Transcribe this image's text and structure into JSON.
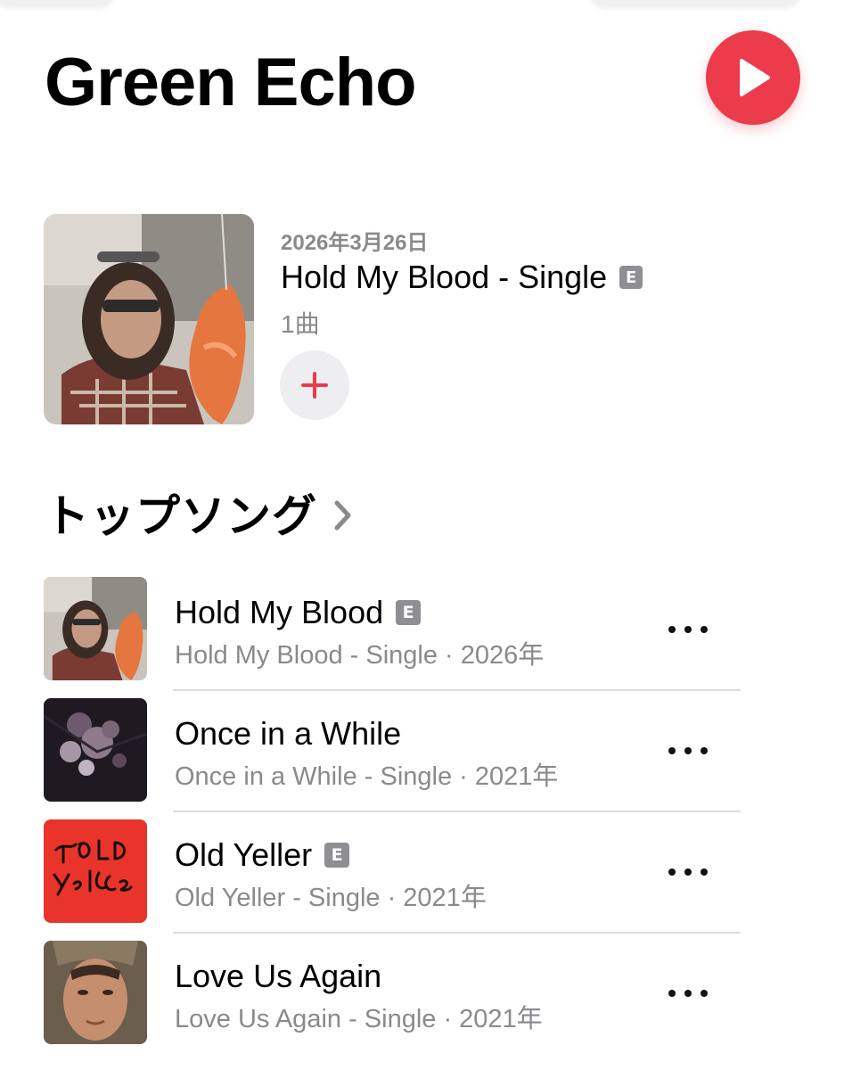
{
  "artist": {
    "name": "Green Echo"
  },
  "colors": {
    "accent": "#ec3b4b",
    "secondary_text": "#8a8a8e",
    "badge": "#8e8e93"
  },
  "icons": {
    "play": "play-icon",
    "add": "plus-icon",
    "chevron": "chevron-right-icon",
    "more": "ellipsis-icon"
  },
  "latest_release": {
    "date": "2026年3月26日",
    "title": "Hold My Blood - Single",
    "explicit_badge": "E",
    "track_count": "1曲"
  },
  "top_songs": {
    "header": "トップソング",
    "items": [
      {
        "title": "Hold My Blood",
        "explicit": true,
        "explicit_badge": "E",
        "subtitle": "Hold My Blood - Single · 2026年"
      },
      {
        "title": "Once in a While",
        "explicit": false,
        "explicit_badge": "",
        "subtitle": "Once in a While - Single · 2021年"
      },
      {
        "title": "Old Yeller",
        "explicit": true,
        "explicit_badge": "E",
        "subtitle": "Old Yeller - Single · 2021年"
      },
      {
        "title": "Love Us Again",
        "explicit": false,
        "explicit_badge": "",
        "subtitle": "Love Us Again - Single · 2021年"
      }
    ]
  }
}
